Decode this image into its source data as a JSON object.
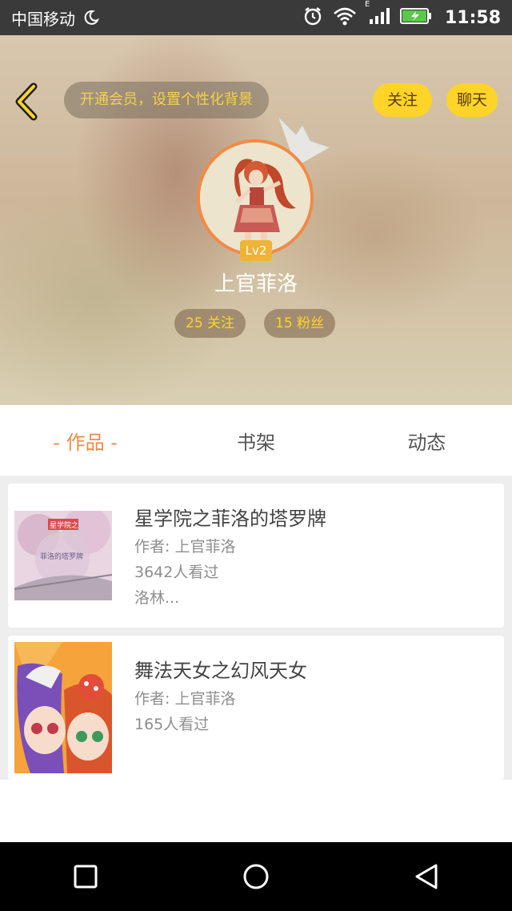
{
  "status_bar": {
    "carrier": "中国移动",
    "time": "11:58",
    "network_type": "E",
    "icons": [
      "moon-icon",
      "alarm-icon",
      "wifi-icon",
      "signal-icon",
      "battery-icon"
    ]
  },
  "header": {
    "vip_text": "开通会员，设置个性化背景",
    "follow_label": "关注",
    "chat_label": "聊天"
  },
  "profile": {
    "level": "Lv2",
    "username": "上官菲洛",
    "following": "25 关注",
    "fans": "15 粉丝"
  },
  "tabs": [
    {
      "label": "- 作品 -",
      "active": true
    },
    {
      "label": "书架",
      "active": false
    },
    {
      "label": "动态",
      "active": false
    }
  ],
  "works": [
    {
      "title": "星学院之菲洛的塔罗牌",
      "author": "作者: 上官菲洛",
      "views": "3642人看过",
      "summary": "洛林...",
      "cover_text": "星学院之",
      "cover_subtext": "菲洛的塔罗牌"
    },
    {
      "title": "舞法天女之幻风天女",
      "author": "作者: 上官菲洛",
      "views": "165人看过"
    }
  ],
  "colors": {
    "accent_orange": "#f08b47",
    "button_yellow": "#ffd428",
    "status_bar": "#3a3a3a"
  }
}
